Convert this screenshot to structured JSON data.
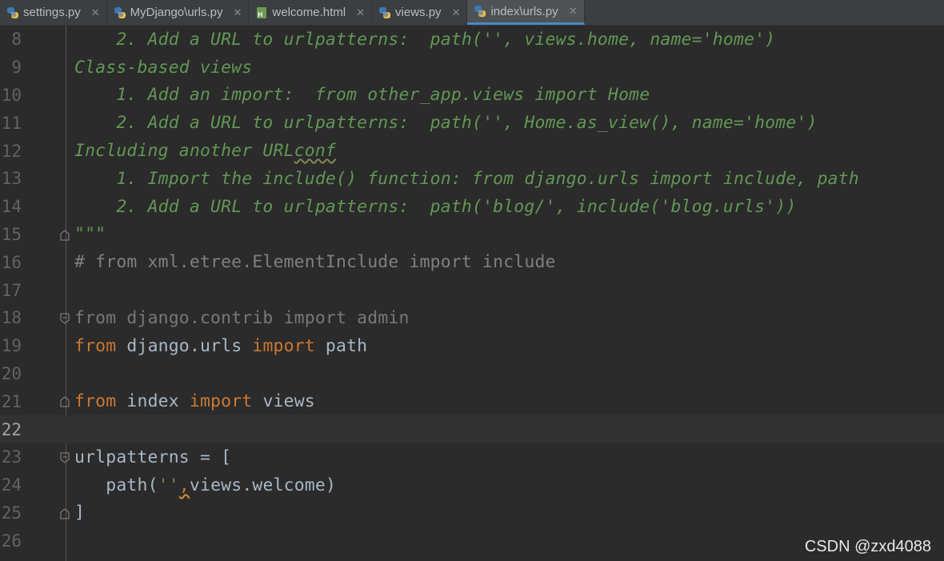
{
  "tabs": [
    {
      "label": "settings.py",
      "icon": "python-file-icon"
    },
    {
      "label": "MyDjango\\urls.py",
      "icon": "python-file-icon"
    },
    {
      "label": "welcome.html",
      "icon": "html-file-icon"
    },
    {
      "label": "views.py",
      "icon": "python-file-icon"
    },
    {
      "label": "index\\urls.py",
      "icon": "python-file-icon",
      "active": true
    }
  ],
  "tab_close_glyph": "✕",
  "lines": {
    "l8": {
      "num": "8",
      "indent": "    ",
      "text": "2. Add a URL to urlpatterns:  path('', views.home, name='home')"
    },
    "l9": {
      "num": "9",
      "text": "Class-based views"
    },
    "l10": {
      "num": "10",
      "indent": "    ",
      "text": "1. Add an import:  from other_app.views import Home"
    },
    "l11": {
      "num": "11",
      "indent": "    ",
      "text": "2. Add a URL to urlpatterns:  path('', Home.as_view(), name='home')"
    },
    "l12": {
      "num": "12",
      "pre": "Including another URL",
      "underlined": "conf"
    },
    "l13": {
      "num": "13",
      "indent": "    ",
      "text": "1. Import the include() function: from django.urls import include, path"
    },
    "l14": {
      "num": "14",
      "indent": "    ",
      "text": "2. Add a URL to urlpatterns:  path('blog/', include('blog.urls'))"
    },
    "l15": {
      "num": "15",
      "text": "\"\"\""
    },
    "l16": {
      "num": "16",
      "text": "# from xml.etree.ElementInclude import include"
    },
    "l17": {
      "num": "17"
    },
    "l18": {
      "num": "18",
      "kw1": "from",
      "mod": " django.contrib ",
      "kw2": "import",
      "name": " admin"
    },
    "l19": {
      "num": "19",
      "kw1": "from",
      "mod": " django.urls ",
      "kw2": "import",
      "name": " path"
    },
    "l20": {
      "num": "20"
    },
    "l21": {
      "num": "21",
      "kw1": "from",
      "mod": " index ",
      "kw2": "import",
      "name": " views"
    },
    "l22": {
      "num": "22"
    },
    "l23": {
      "num": "23",
      "text": "urlpatterns = ["
    },
    "l24": {
      "num": "24",
      "indent": "   ",
      "call": "path(",
      "str": "''",
      "comma": ",",
      "rest": "views.welcome)"
    },
    "l25": {
      "num": "25",
      "text": "]"
    },
    "l26": {
      "num": "26"
    }
  },
  "watermark": "CSDN @zxd4088"
}
